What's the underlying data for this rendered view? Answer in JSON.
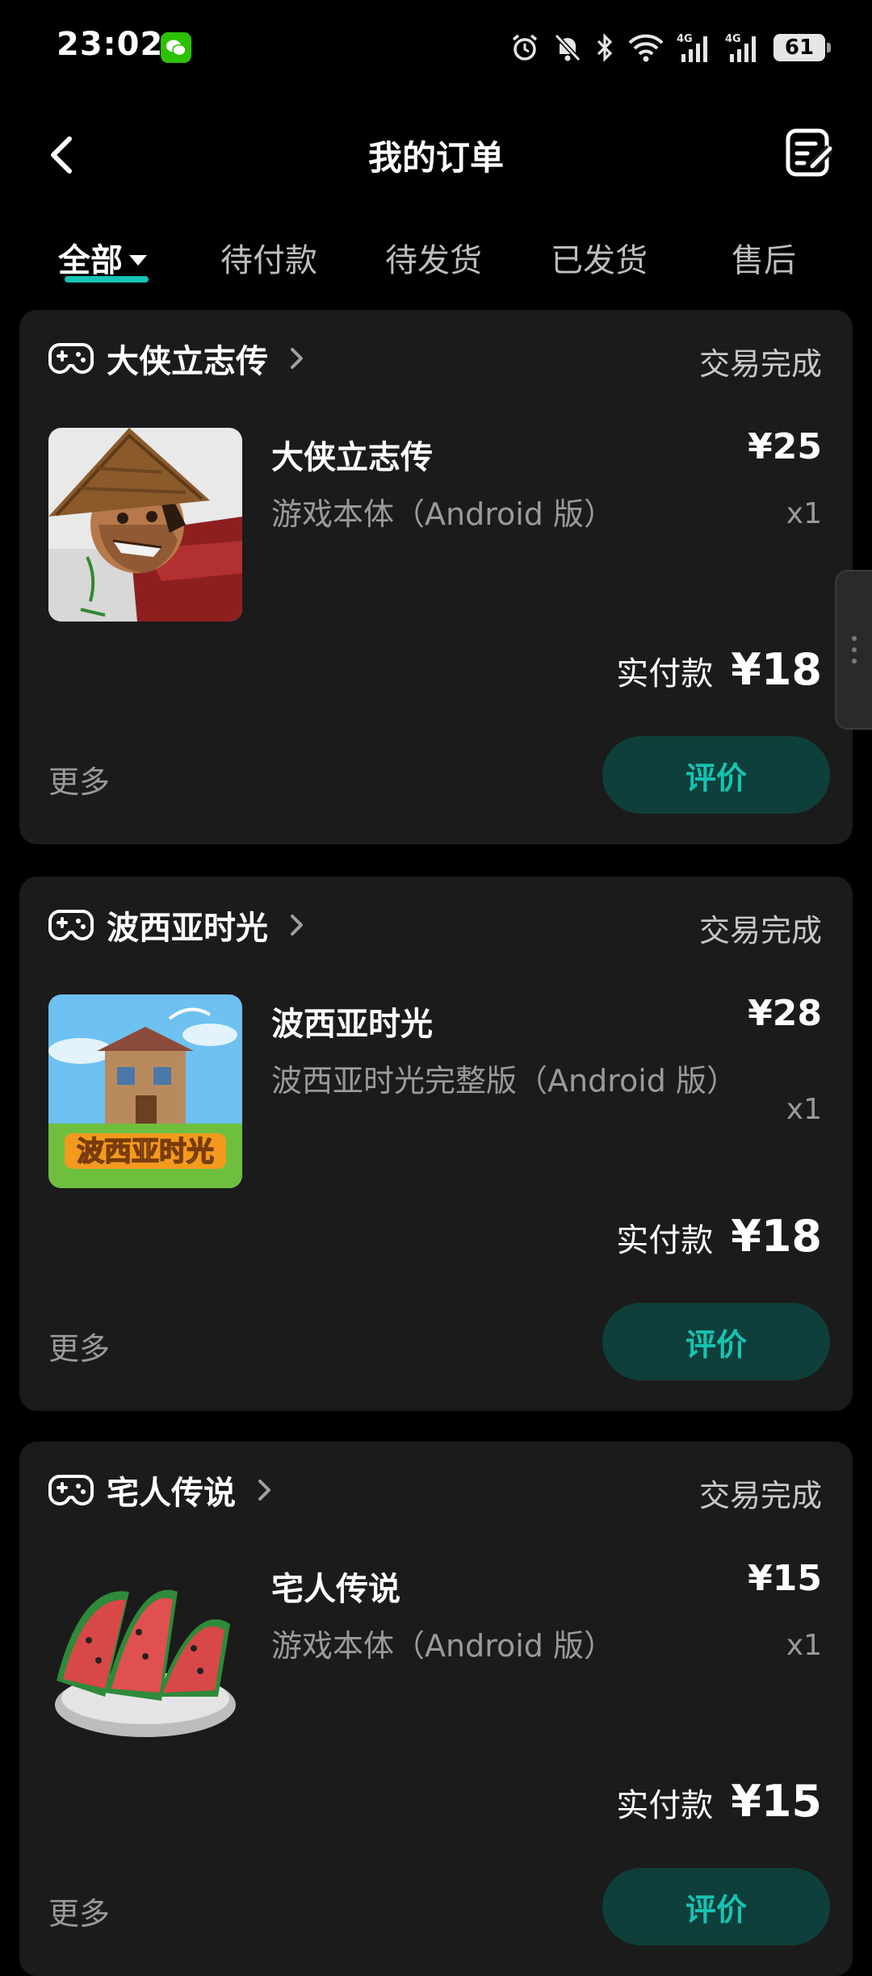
{
  "status_bar": {
    "time": "23:02",
    "battery": "61",
    "icons": [
      "wechat-icon",
      "alarm-icon",
      "bell-off-icon",
      "bluetooth-icon",
      "wifi-icon",
      "signal-4g-icon",
      "signal-4g-icon",
      "battery-icon"
    ]
  },
  "header": {
    "title": "我的订单",
    "back_icon": "chevron-left-icon",
    "action_icon": "edit-list-icon"
  },
  "tabs": [
    {
      "label": "全部",
      "active": true
    },
    {
      "label": "待付款"
    },
    {
      "label": "待发货"
    },
    {
      "label": "已发货"
    },
    {
      "label": "售后"
    }
  ],
  "colors": {
    "accent": "#16c3b4",
    "button_bg": "#0f3f3a",
    "card_bg": "#1b1b1b"
  },
  "orders": [
    {
      "shop": "大侠立志传",
      "status": "交易完成",
      "product_name": "大侠立志传",
      "variant": "游戏本体（Android 版）",
      "price": "¥25",
      "qty": "x1",
      "paid_label": "实付款",
      "paid_value": "¥18",
      "more": "更多",
      "action": "评价"
    },
    {
      "shop": "波西亚时光",
      "status": "交易完成",
      "product_name": "波西亚时光",
      "variant": "波西亚时光完整版（Android 版）",
      "price": "¥28",
      "qty": "x1",
      "paid_label": "实付款",
      "paid_value": "¥18",
      "more": "更多",
      "action": "评价"
    },
    {
      "shop": "宅人传说",
      "status": "交易完成",
      "product_name": "宅人传说",
      "variant": "游戏本体（Android 版）",
      "price": "¥15",
      "qty": "x1",
      "paid_label": "实付款",
      "paid_value": "¥15",
      "more": "更多",
      "action": "评价"
    }
  ]
}
